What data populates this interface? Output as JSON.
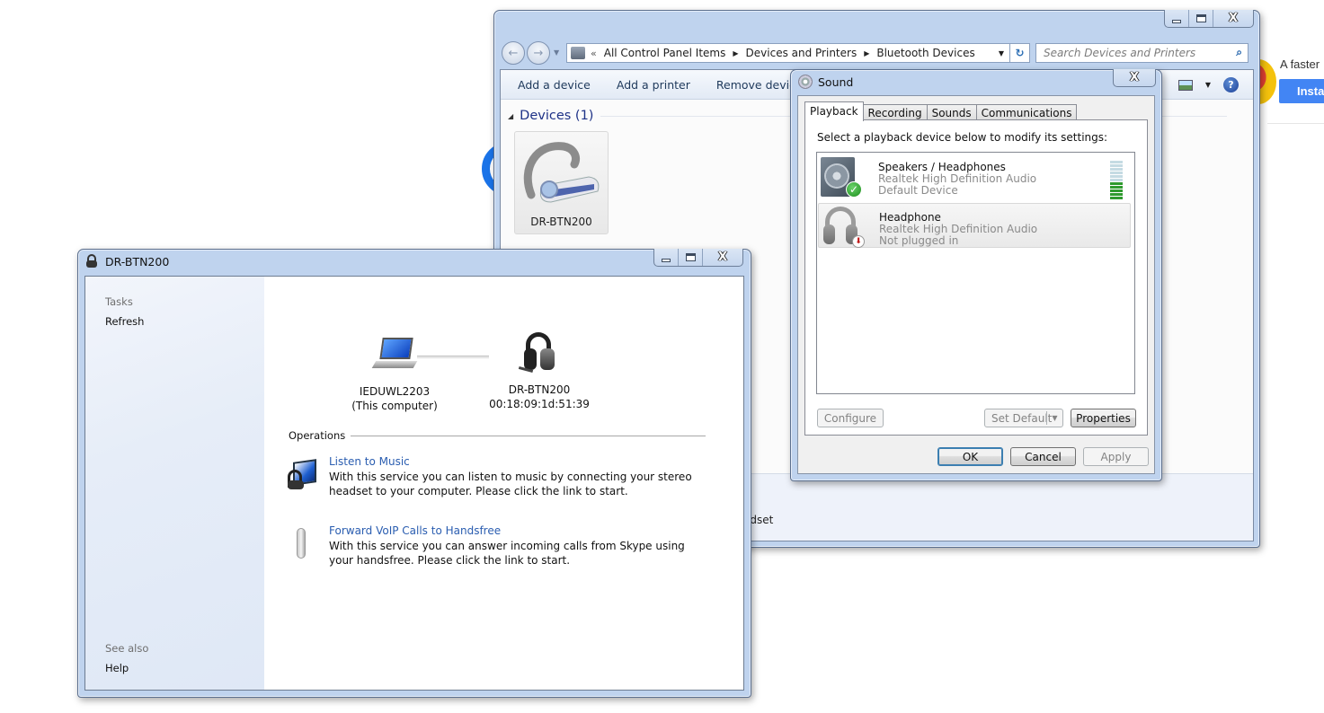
{
  "background_page": {
    "promo_text": "A faster",
    "install_button": "Insta"
  },
  "explorer": {
    "nav": {
      "back_label": "←",
      "forward_label": "→",
      "breadcrumb_overflow": "«",
      "breadcrumbs": [
        "All Control Panel Items",
        "Devices and Printers",
        "Bluetooth Devices"
      ],
      "breadcrumb_separator": "▶",
      "dropdown_glyph": "▼",
      "refresh_glyph": "↻",
      "search_placeholder": "Search Devices and Printers",
      "search_glyph": "⌕"
    },
    "commands": [
      "Add a device",
      "Add a printer",
      "Remove device"
    ],
    "help_glyph": "?",
    "view_dropdown_glyph": "▼",
    "group": {
      "collapse_glyph": "◢",
      "title": "Devices (1)"
    },
    "devices": [
      {
        "name": "DR-BTN200"
      }
    ],
    "details_pane_text": "adset"
  },
  "sound_dialog": {
    "title": "Sound",
    "tabs": [
      {
        "label": "Playback",
        "active": true
      },
      {
        "label": "Recording",
        "active": false
      },
      {
        "label": "Sounds",
        "active": false
      },
      {
        "label": "Communications",
        "active": false
      }
    ],
    "intro": "Select a playback device below to modify its settings:",
    "devices": [
      {
        "name": "Speakers / Headphones",
        "driver": "Realtek High Definition Audio",
        "status": "Default Device",
        "badge": "✓",
        "level_segments_lit": 5,
        "level_segments_total": 11
      },
      {
        "name": "Headphone",
        "driver": "Realtek High Definition Audio",
        "status": "Not plugged in",
        "badge": "⬇",
        "selected": true
      }
    ],
    "buttons": {
      "configure": "Configure",
      "set_default": "Set Default",
      "set_default_dropdown": "▼",
      "properties": "Properties",
      "ok": "OK",
      "cancel": "Cancel",
      "apply": "Apply"
    },
    "close_glyph": "X"
  },
  "device_window": {
    "title": "DR-BTN200",
    "close_glyph": "X",
    "sidebar": {
      "tasks_header": "Tasks",
      "tasks": [
        "Refresh"
      ],
      "see_also_header": "See also",
      "see_also": [
        "Help"
      ]
    },
    "computer": {
      "name": "IEDUWL2203",
      "caption": "(This computer)"
    },
    "remote_device": {
      "name": "DR-BTN200",
      "address": "00:18:09:1d:51:39"
    },
    "operations_header": "Operations",
    "operations": [
      {
        "title": "Listen to Music",
        "description": "With this service you can listen to music by connecting your stereo headset to your computer. Please click the link to start."
      },
      {
        "title": "Forward VoIP Calls to Handsfree",
        "description": "With this service you can answer incoming calls from Skype using your handsfree. Please click the link to start."
      }
    ]
  },
  "caption_glyph_close": "X"
}
